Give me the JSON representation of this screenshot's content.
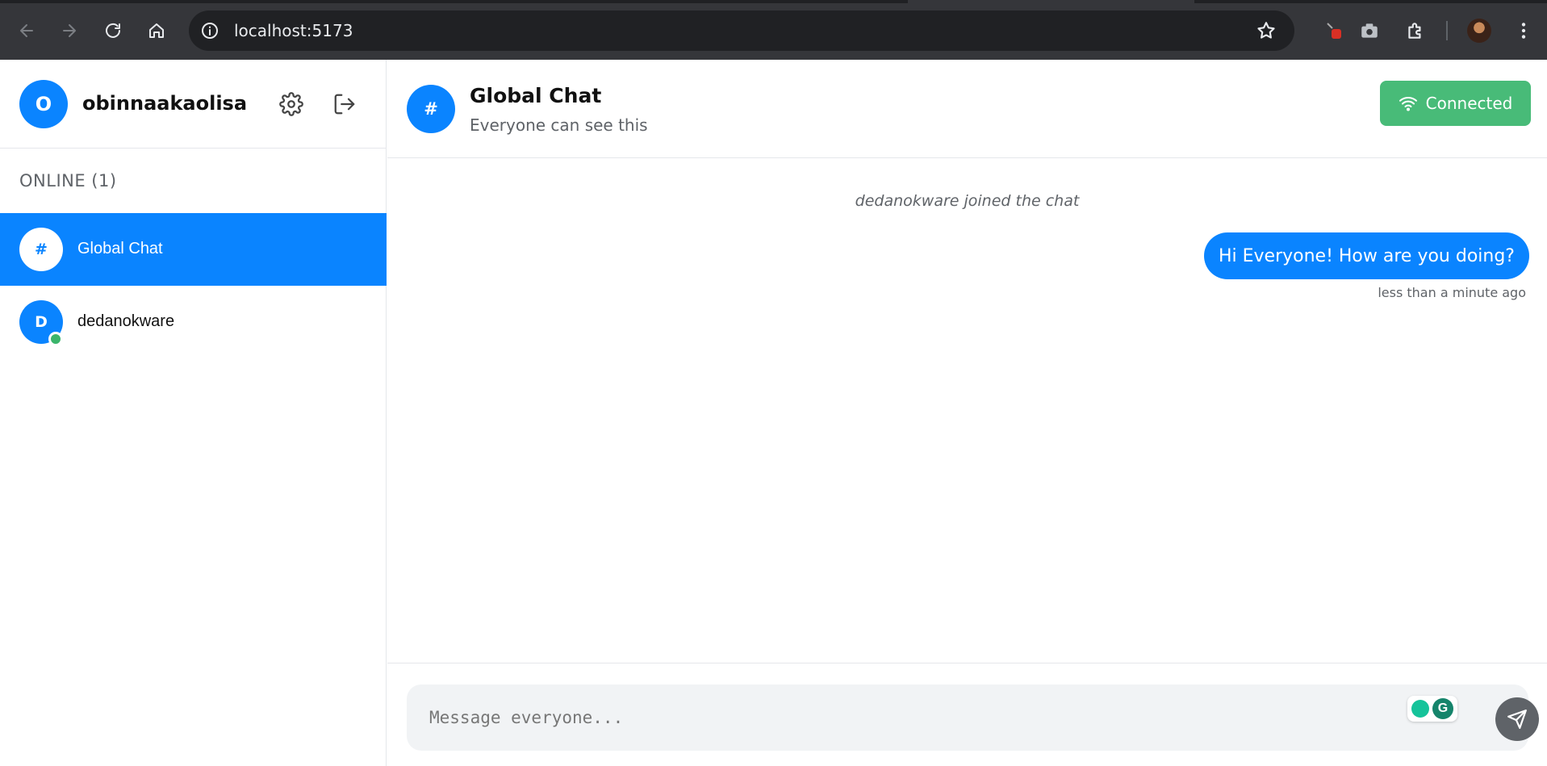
{
  "browser": {
    "url": "localhost:5173"
  },
  "sidebar": {
    "user_initial": "O",
    "username": "obinnaakaolisa",
    "online_title": "ONLINE (1)",
    "items": [
      {
        "initial": "#",
        "label": "Global Chat",
        "active": true
      },
      {
        "initial": "D",
        "label": "dedanokware",
        "active": false,
        "online": true
      }
    ]
  },
  "chat": {
    "avatar": "#",
    "title": "Global Chat",
    "subtitle": "Everyone can see this",
    "status_label": "Connected",
    "status_color": "#48bb78",
    "accent_color": "#0a84ff"
  },
  "messages": {
    "system": "dedanokware joined the chat",
    "own_message": "Hi Everyone! How are you doing?",
    "own_time": "less than a minute ago"
  },
  "composer": {
    "placeholder": "Message everyone...",
    "grammarly_letter": "G"
  }
}
